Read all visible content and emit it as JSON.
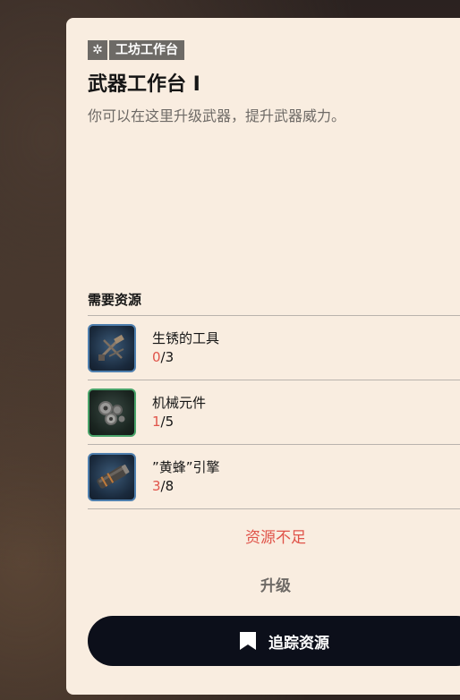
{
  "panel": {
    "category_icon": "gear-icon",
    "category_label": "工坊工作台",
    "title": "武器工作台 I",
    "description": "你可以在这里升级武器，提升武器威力。",
    "requirements_title": "需要资源",
    "resources": [
      {
        "name": "生锈的工具",
        "have": "0",
        "need": "/3",
        "icon": "rusty-tools-icon",
        "rarity_color": "#4f7fae"
      },
      {
        "name": "机械元件",
        "have": "1",
        "need": "/5",
        "icon": "mechanical-parts-icon",
        "rarity_color": "#49a36a"
      },
      {
        "name": "”黄蜂”引擎",
        "have": "3",
        "need": "/8",
        "icon": "engine-icon",
        "rarity_color": "#4f7fae"
      }
    ],
    "insufficient_text": "资源不足",
    "upgrade_label": "升级",
    "track_button_label": "追踪资源",
    "track_button_icon": "bookmark-icon",
    "colors": {
      "panel_bg": "#f9ede0",
      "warning": "#e0544a",
      "button_bg": "#0c0f1a"
    }
  }
}
